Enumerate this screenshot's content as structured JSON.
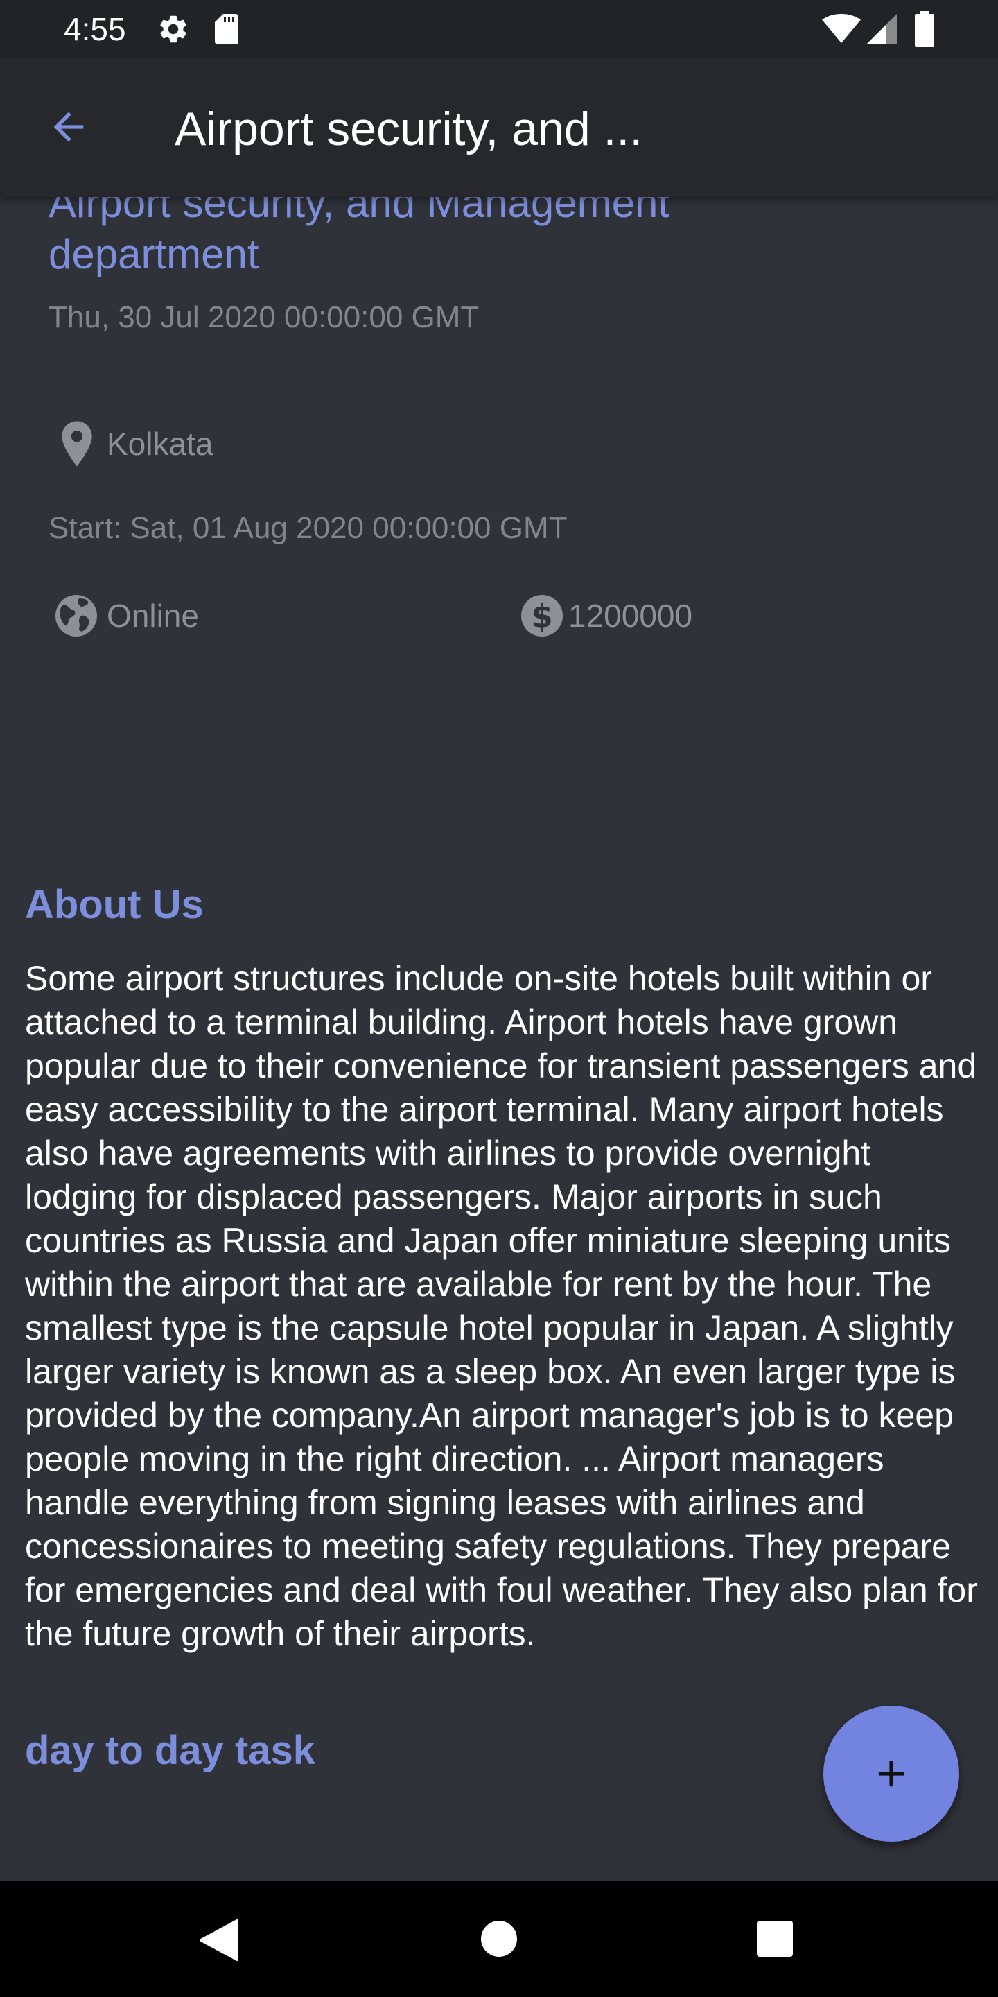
{
  "status_bar": {
    "time": "4:55",
    "icons": [
      "gear-icon",
      "sd-card-icon",
      "wifi-icon",
      "cell-signal-icon",
      "battery-icon"
    ]
  },
  "app_bar": {
    "title": "Airport security, and ...",
    "back_icon": "arrow-left-icon"
  },
  "event": {
    "title": "Airport security, and Management department",
    "posted_date": "Thu, 30 Jul 2020 00:00:00 GMT",
    "location": "Kolkata",
    "start": "Start: Sat, 01 Aug 2020 00:00:00 GMT",
    "mode": "Online",
    "budget": "1200000"
  },
  "about": {
    "heading": "About Us",
    "body": "Some airport structures include on-site hotels built within or attached to a terminal building. Airport hotels have grown popular due to their convenience for transient passengers and easy accessibility to the airport terminal. Many airport hotels also have agreements with airlines to provide overnight lodging for displaced passengers. Major airports in such countries as Russia and Japan offer miniature sleeping units within the airport that are available for rent by the hour. The smallest type is the capsule hotel popular in Japan. A slightly larger variety is known as a sleep box. An even larger type is provided by the company.An airport manager's job is to keep people moving in the right direction. ... Airport managers handle everything from signing leases with airlines and concessionaires to meeting safety regulations. They prepare for emergencies and deal with foul weather. They also plan for the future growth of their airports."
  },
  "tasks": {
    "heading": "day to day task"
  },
  "fab": {
    "icon": "plus-icon"
  },
  "colors": {
    "accent": "#7d8fdc",
    "fab": "#7283e0",
    "background": "#2f3239",
    "app_bar": "#26282c",
    "status_bar": "#212326"
  }
}
